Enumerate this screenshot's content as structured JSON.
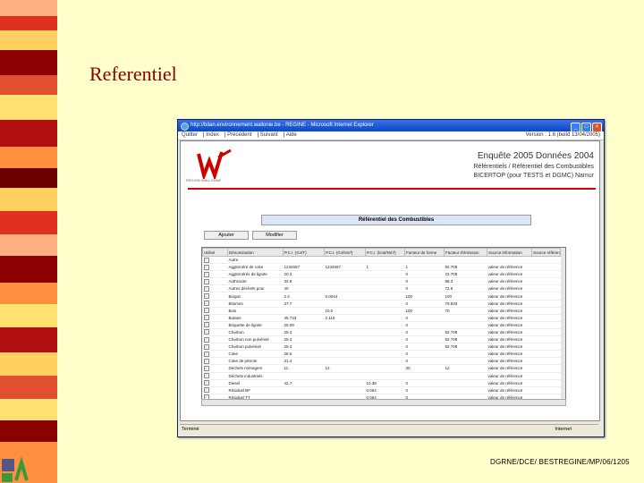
{
  "slide": {
    "title": "Referentiel",
    "footer": "DGRNE/DCE/ BESTREGINE/MP/06/1205"
  },
  "colors": {
    "background": "#ffffcc",
    "stripe": [
      "#e03020",
      "#ffd060",
      "#8b0000",
      "#e05030",
      "#ffe070",
      "#b01010",
      "#ff9040",
      "#6b0000"
    ],
    "title": "#8b0000"
  },
  "browser": {
    "title": "http://bilan.environnement.wallonie.be - REGINE - Microsoft Internet Explorer",
    "menu": [
      "Quitter",
      "Index",
      "Précédent",
      "Suivant",
      "Aide"
    ],
    "version": "Version : 1.6 (build 13/04/2005)",
    "status_left": "Terminé",
    "status_right": "Internet"
  },
  "page": {
    "logo_text": "RÉGION WALLONNE",
    "heading1": "Enquête 2005 Données 2004",
    "heading2": "Référentiels / Référentiel des Combustibles",
    "heading3": "BICERTOP (pour TESTS et DGMC) Namur",
    "section_title": "Référentiel des Combustibles",
    "add_button": "Ajouter",
    "modify_button": "Modifier"
  },
  "table": {
    "headers": [
      "Utilisé",
      "Dénomination",
      "P.C.I. (GJ/T)",
      "P.C.I. (GJ/Nm³)",
      "P.C.I. (kcal/Nm³)",
      "Facteur de forme",
      "Facteur d'émission",
      "Source information",
      "Source référence"
    ],
    "rows": [
      [
        "✓",
        "Autre",
        "",
        "",
        "",
        "",
        "",
        "",
        ""
      ],
      [
        "✓",
        "Aggloméré de coke",
        "1234567",
        "1234567",
        "1",
        "1",
        "92.708",
        "valeur de référence",
        ""
      ],
      [
        "✓",
        "Agglomérés de lignite",
        "20.3",
        "",
        "",
        "0",
        "22.708",
        "valeur de référence",
        ""
      ],
      [
        "✓",
        "Anthracite",
        "34.9",
        "",
        "",
        "0",
        "98.3",
        "valeur de référence",
        ""
      ],
      [
        "✓",
        "Autres déchets pour",
        "40",
        "",
        "",
        "0",
        "72.6",
        "valeur de référence",
        ""
      ],
      [
        "✓",
        "Biogaz",
        "2.4",
        "0.0044",
        "",
        "100",
        "100",
        "valeur de référence",
        ""
      ],
      [
        "✓",
        "Bitumes",
        "37.7",
        "",
        "",
        "0",
        "79.833",
        "valeur de référence",
        ""
      ],
      [
        "✓",
        "Bois",
        "",
        "10.0",
        "",
        "100",
        "70",
        "valeur de référence",
        ""
      ],
      [
        "✓",
        "Butane",
        "45.733",
        "2.115",
        "",
        "0",
        "",
        "valeur de référence",
        ""
      ],
      [
        "✓",
        "Briquette de lignite",
        "20.09",
        "",
        "",
        "0",
        "",
        "valeur de référence",
        ""
      ],
      [
        "✓",
        "Charbon",
        "29.3",
        "",
        "",
        "0",
        "92.708",
        "valeur de référence",
        ""
      ],
      [
        "✓",
        "Charbon non pulvérisé",
        "29.3",
        "",
        "",
        "0",
        "92.708",
        "valeur de référence",
        ""
      ],
      [
        "✓",
        "Charbon pulvérisé",
        "29.3",
        "",
        "",
        "0",
        "92.708",
        "valeur de référence",
        ""
      ],
      [
        "✓",
        "Coke",
        "28.5",
        "",
        "",
        "0",
        "",
        "valeur de référence",
        ""
      ],
      [
        "✓",
        "Coke de pétrole",
        "31.4",
        "",
        "",
        "0",
        "",
        "valeur de référence",
        ""
      ],
      [
        "✓",
        "Déchets ménagers",
        "11",
        "12",
        "",
        "30",
        "12",
        "valeur de référence",
        ""
      ],
      [
        "✓",
        "Déchets industriels",
        "",
        "",
        "",
        "",
        "",
        "valeur de référence",
        ""
      ],
      [
        "✓",
        "Diesel",
        "42.7",
        "",
        "10.38",
        "0",
        "",
        "valeur de référence",
        ""
      ],
      [
        "✓",
        "Résiduel BF",
        "",
        "",
        "0.064",
        "0",
        "",
        "valeur de référence",
        ""
      ],
      [
        "✓",
        "Résiduel TT",
        "",
        "",
        "0.064",
        "0",
        "",
        "valeur de référence",
        ""
      ]
    ]
  }
}
